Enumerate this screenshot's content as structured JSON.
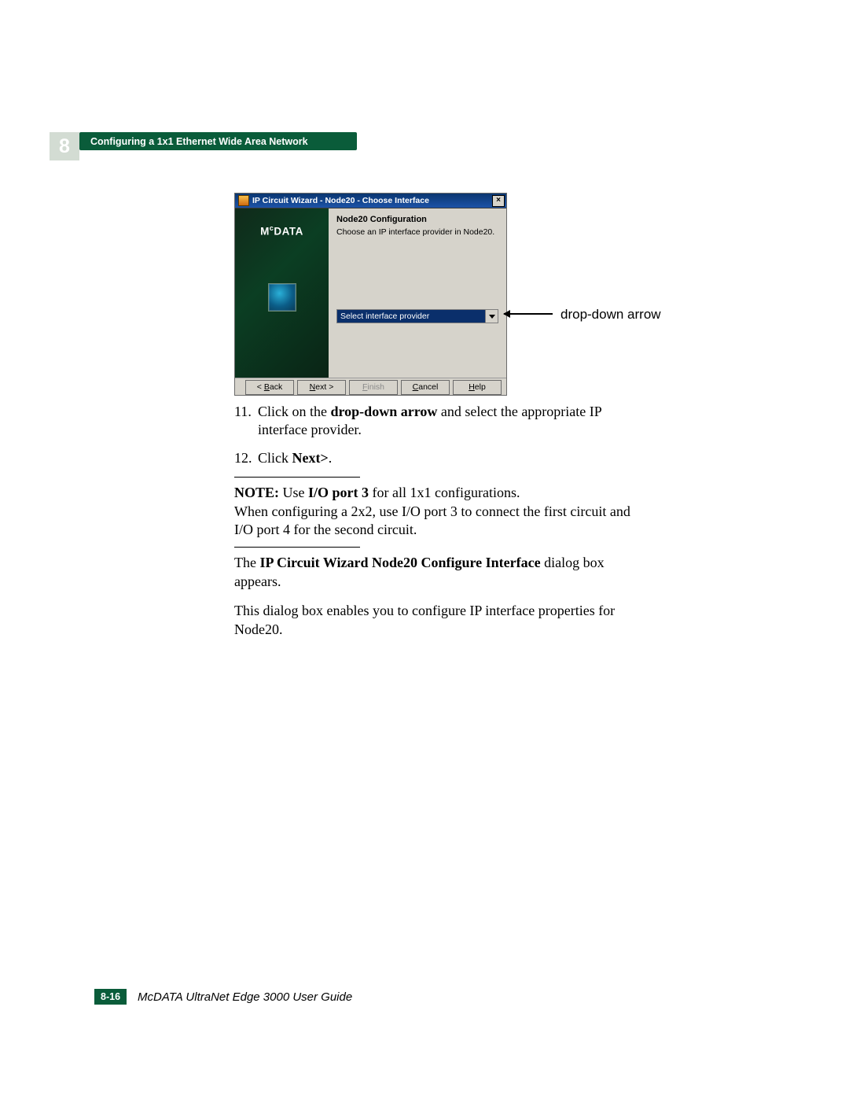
{
  "chapter": {
    "number": "8",
    "title": "Configuring a 1x1 Ethernet Wide Area Network"
  },
  "dialog": {
    "title": "IP Circuit Wizard - Node20 - Choose Interface",
    "brand": "M",
    "brand_sup": "c",
    "brand_rest": "DATA",
    "heading": "Node20 Configuration",
    "prompt": "Choose an IP interface provider in Node20.",
    "select_value": "Select interface provider",
    "buttons": {
      "back": "< Back",
      "next": "Next >",
      "finish": "Finish",
      "cancel": "Cancel",
      "help": "Help"
    }
  },
  "callout": "drop-down arrow",
  "steps": {
    "s11_num": "11.",
    "s11_a": "Click on the ",
    "s11_b": "drop-down arrow",
    "s11_c": " and select the appropriate IP interface provider.",
    "s12_num": "12.",
    "s12_a": "Click ",
    "s12_b": "Next>",
    "s12_c": "."
  },
  "note": {
    "label": "NOTE: ",
    "a": "Use ",
    "b": "I/O port 3",
    "c": " for all 1x1 configurations.",
    "line2": "When configuring a 2x2, use I/O port 3 to connect the first circuit and I/O port 4 for the second circuit."
  },
  "after": {
    "p1_a": "The ",
    "p1_b": "IP Circuit Wizard Node20 Configure Interface",
    "p1_c": " dialog box appears.",
    "p2": "This dialog box enables you to configure IP interface properties for Node20."
  },
  "footer": {
    "page": "8-16",
    "book": "McDATA UltraNet Edge 3000 User Guide"
  }
}
